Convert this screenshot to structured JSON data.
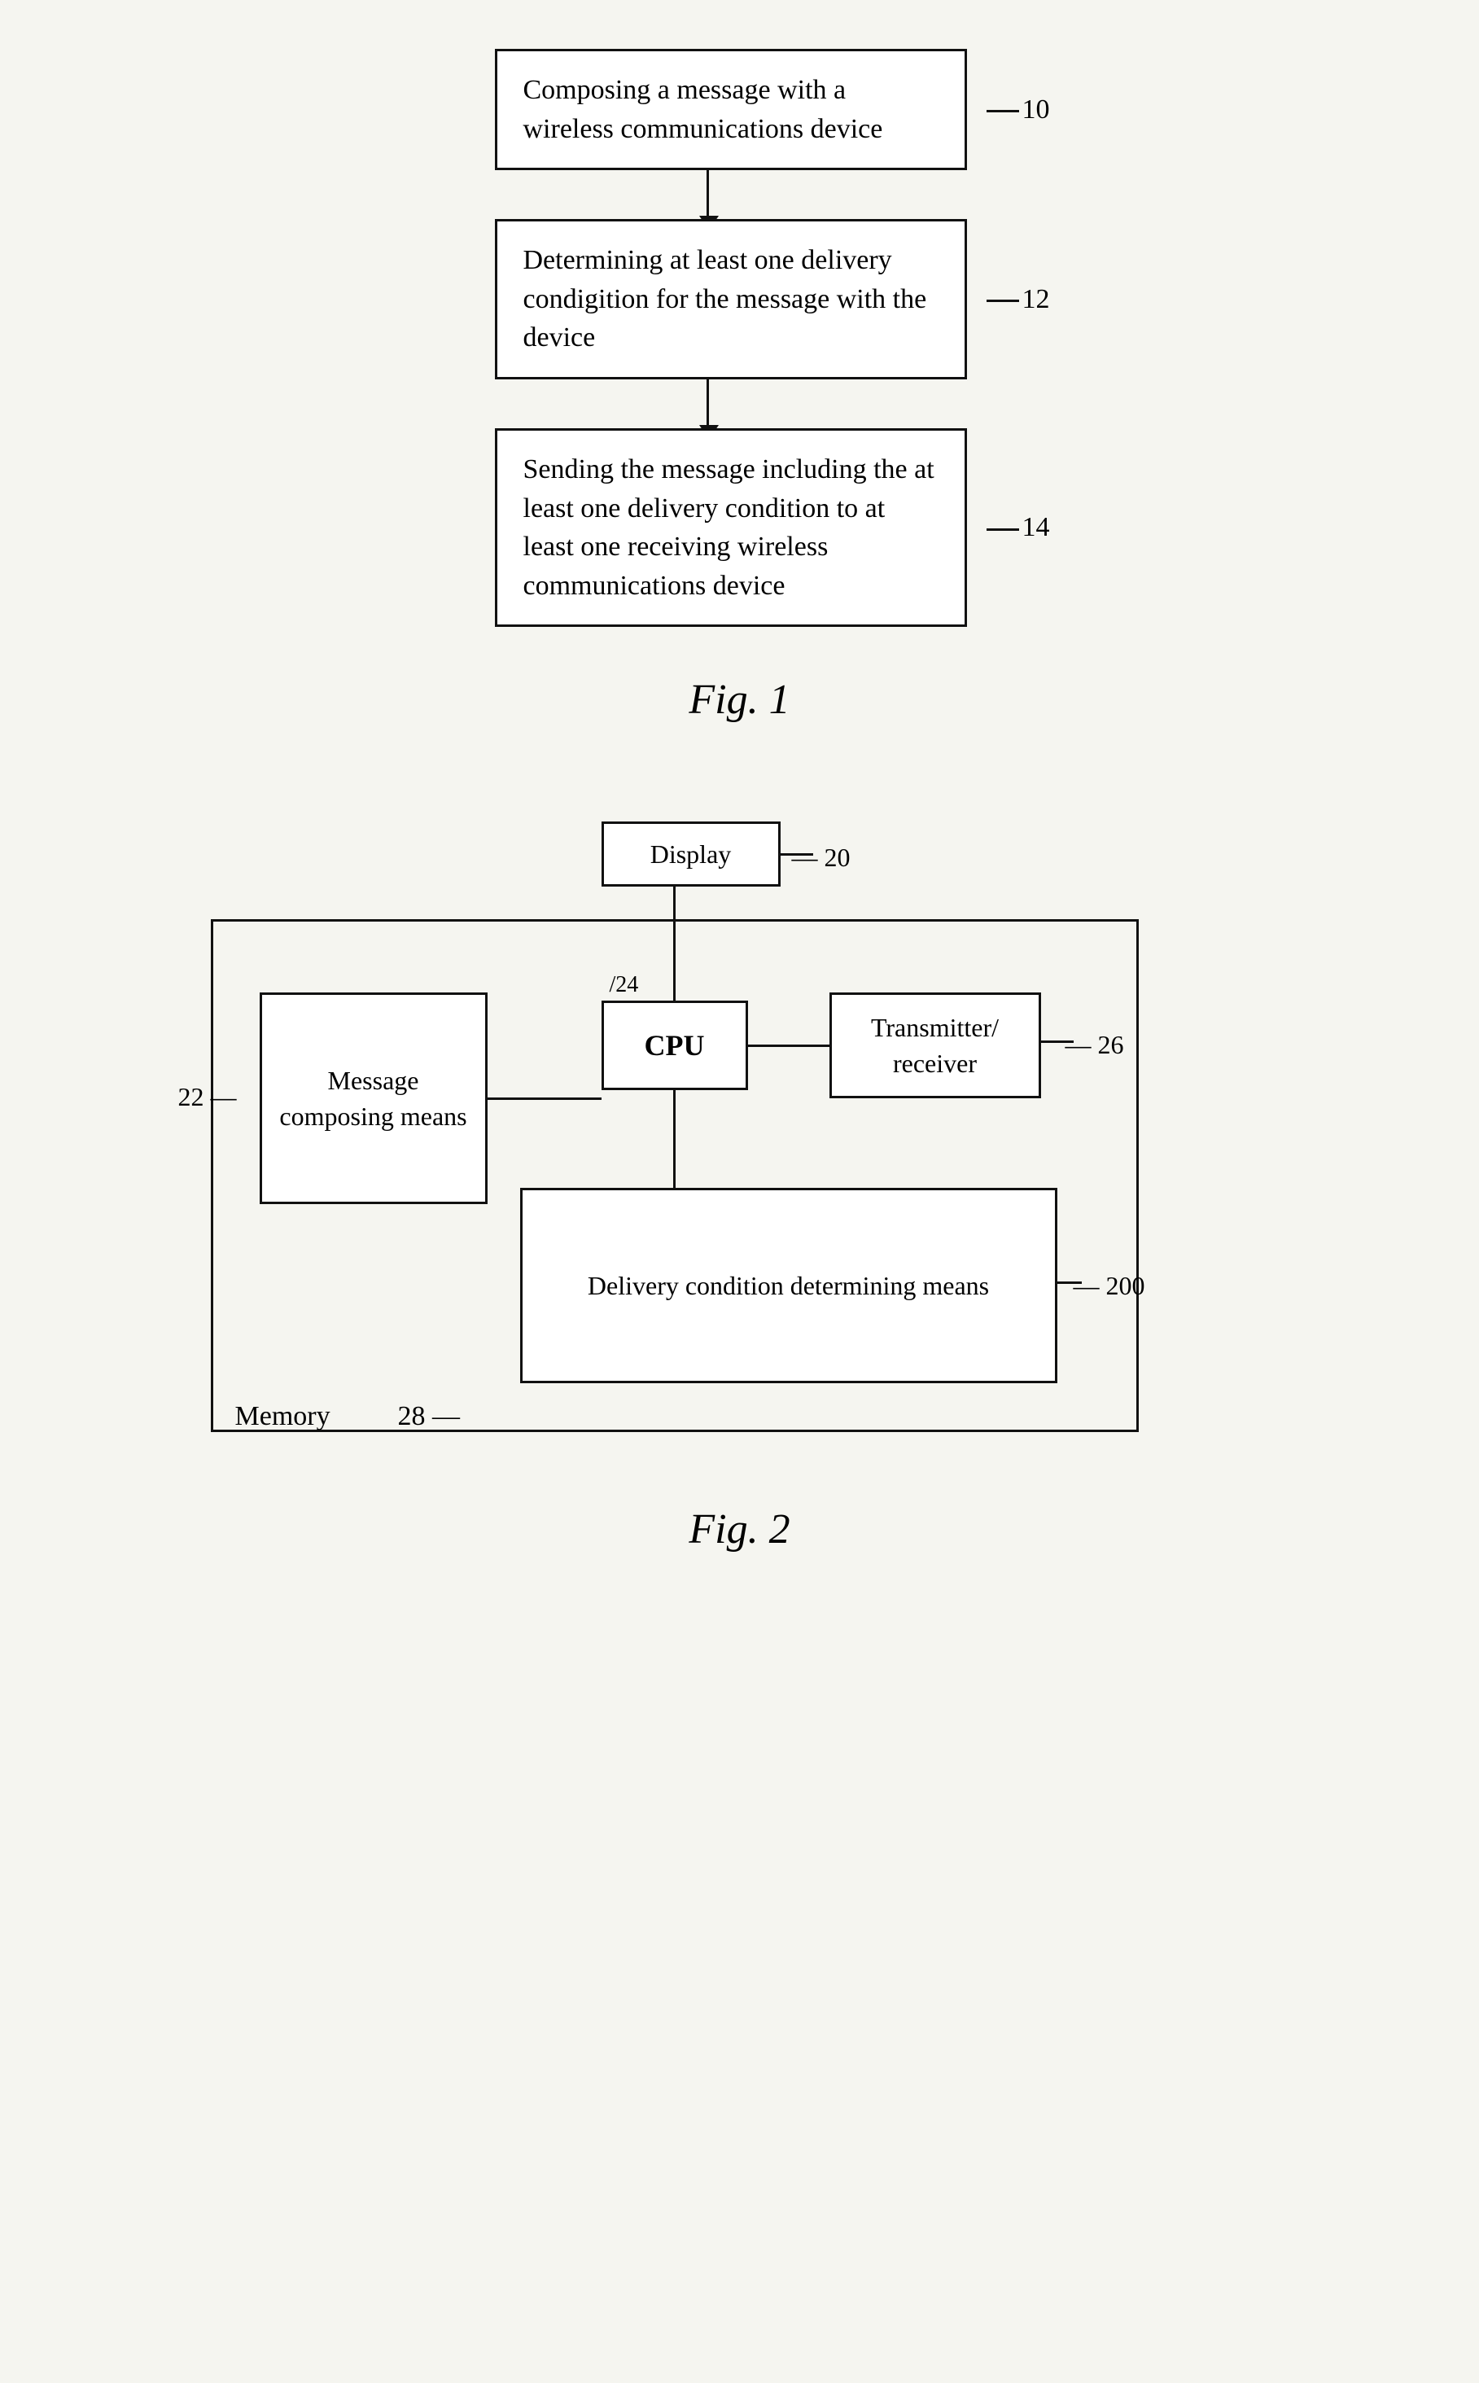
{
  "fig1": {
    "label": "Fig. 1",
    "steps": [
      {
        "id": "step1",
        "text": "Composing a message with a wireless communications device",
        "ref": "10"
      },
      {
        "id": "step2",
        "text": "Determining at least one delivery condigition for the message with the device",
        "ref": "12"
      },
      {
        "id": "step3",
        "text": "Sending the message including the at least one delivery condition to at least one receiving wireless communications device",
        "ref": "14"
      }
    ]
  },
  "fig2": {
    "label": "Fig. 2",
    "elements": {
      "display": {
        "label": "Display",
        "ref": "20"
      },
      "cpu": {
        "label": "CPU",
        "ref": "24"
      },
      "transceiver": {
        "label": "Transmitter/\nreceiver",
        "ref": "26"
      },
      "message_composing": {
        "label": "Message composing means",
        "ref": "22"
      },
      "delivery_condition": {
        "label": "Delivery condition determining means",
        "ref": "200"
      },
      "memory": {
        "label": "Memory",
        "ref": "28"
      }
    }
  }
}
